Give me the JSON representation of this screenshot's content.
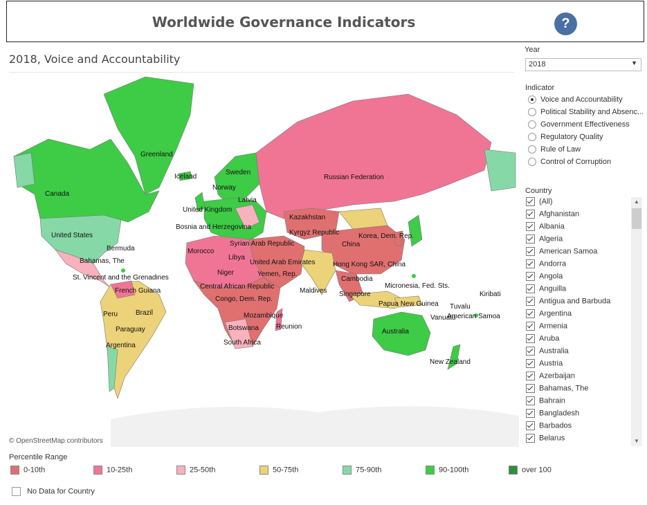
{
  "header": {
    "title": "Worldwide Governance Indicators",
    "help_glyph": "?"
  },
  "subtitle": "2018, Voice and Accountability",
  "map": {
    "attribution": "© OpenStreetMap contributors",
    "labels": [
      "Greenland",
      "Iceland",
      "Sweden",
      "Norway",
      "Canada",
      "Russian Federation",
      "Latvia",
      "United Kingdom",
      "Kazakhstan",
      "Bosnia and Herzegovina",
      "Kyrgyz Republic",
      "United States",
      "Korea, Dem. Rep.",
      "Syrian Arab Republic",
      "China",
      "Bermuda",
      "Morocco",
      "Libya",
      "United Arab Emirates",
      "Bahamas, The",
      "Hong Kong SAR, China",
      "Niger",
      "Yemen, Rep.",
      "St. Vincent and the Grenadines",
      "Cambodia",
      "French Guiana",
      "Central African Republic",
      "Micronesia, Fed. Sts.",
      "Maldives",
      "Kiribati",
      "Singapore",
      "Congo, Dem. Rep.",
      "Papua New Guinea",
      "Tuvalu",
      "Peru",
      "Brazil",
      "Vanuatu",
      "American Samoa",
      "Mozambique",
      "Reunion",
      "Paraguay",
      "Botswana",
      "Australia",
      "South Africa",
      "Argentina",
      "New Zealand"
    ]
  },
  "sidebar": {
    "year_label": "Year",
    "year_value": "2018",
    "indicator_label": "Indicator",
    "indicators": [
      {
        "label": "Voice and Accountability",
        "selected": true
      },
      {
        "label": "Political Stability and Absenc...",
        "selected": false
      },
      {
        "label": "Government Effectiveness",
        "selected": false
      },
      {
        "label": "Regulatory Quality",
        "selected": false
      },
      {
        "label": "Rule of Law",
        "selected": false
      },
      {
        "label": "Control of Corruption",
        "selected": false
      }
    ],
    "country_label": "Country",
    "countries": [
      "(All)",
      "Afghanistan",
      "Albania",
      "Algeria",
      "American Samoa",
      "Andorra",
      "Angola",
      "Anguilla",
      "Antigua and Barbuda",
      "Argentina",
      "Armenia",
      "Aruba",
      "Australia",
      "Austria",
      "Azerbaijan",
      "Bahamas, The",
      "Bahrain",
      "Bangladesh",
      "Barbados",
      "Belarus"
    ]
  },
  "legend": {
    "title": "Percentile Range",
    "items": [
      {
        "label": "0-10th",
        "color": "#e07070"
      },
      {
        "label": "10-25th",
        "color": "#f07595"
      },
      {
        "label": "25-50th",
        "color": "#f7b2bd"
      },
      {
        "label": "50-75th",
        "color": "#ecd278"
      },
      {
        "label": "75-90th",
        "color": "#86d9a6"
      },
      {
        "label": "90-100th",
        "color": "#3ecb46"
      },
      {
        "label": "over 100",
        "color": "#2f8f3a"
      }
    ],
    "no_data_label": "No Data for Country"
  }
}
